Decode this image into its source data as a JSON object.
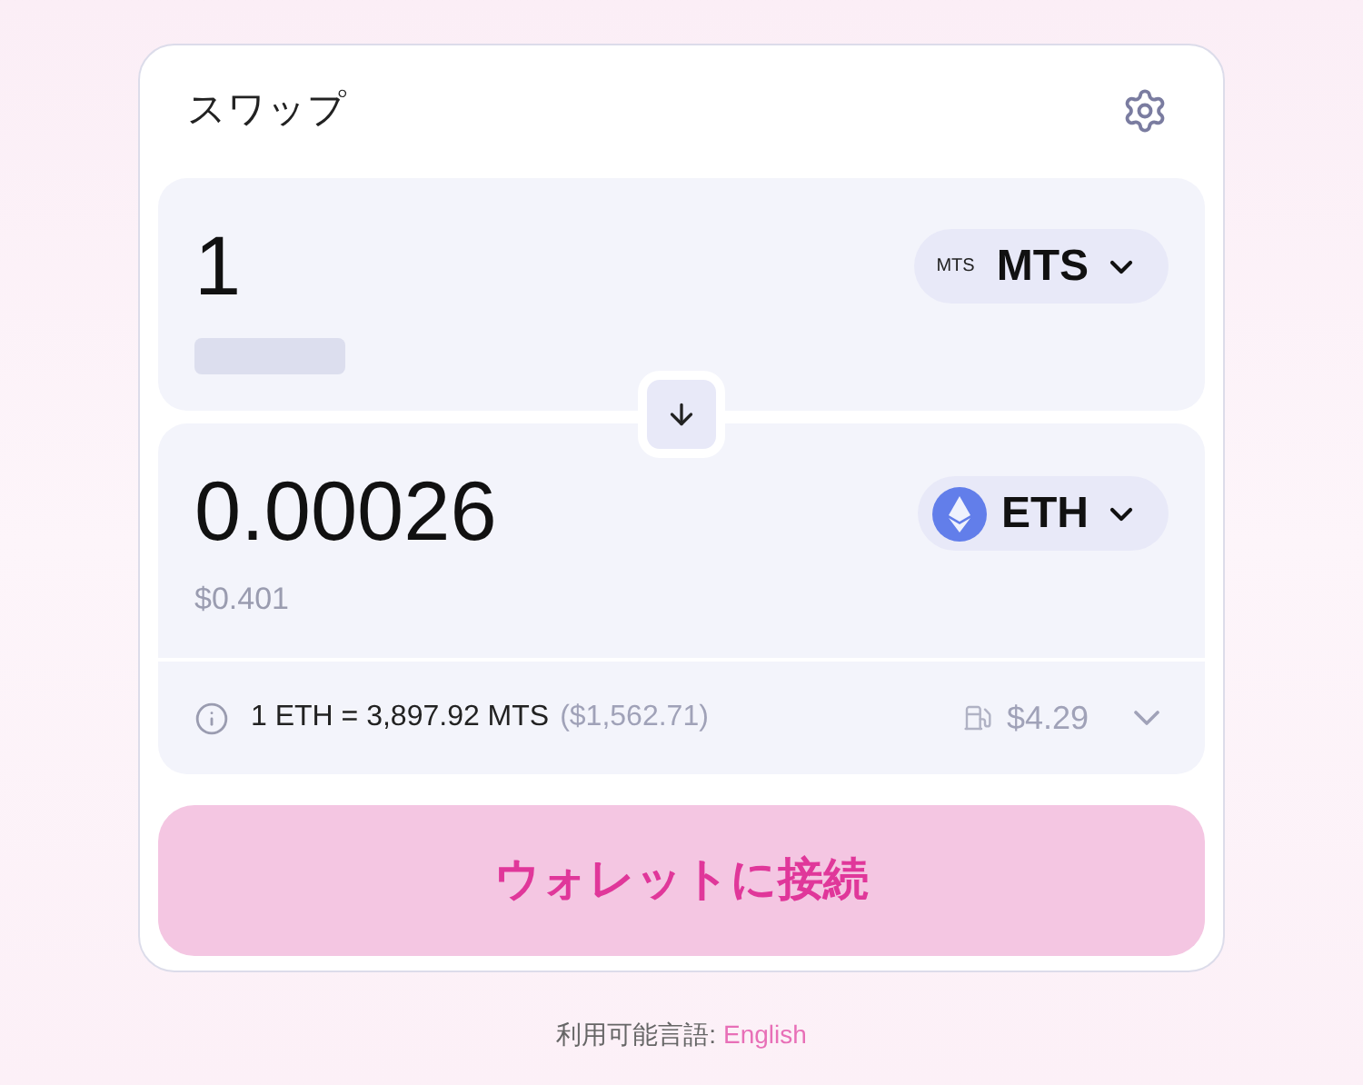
{
  "title": "スワップ",
  "sell": {
    "amount": "1",
    "usd_loading": true,
    "token": {
      "symbol": "MTS",
      "logo_text": "MTS",
      "kind": "text"
    }
  },
  "buy": {
    "amount": "0.00026",
    "usd": "$0.401",
    "token": {
      "symbol": "ETH",
      "kind": "eth"
    }
  },
  "rate": {
    "text": "1 ETH = 3,897.92 MTS",
    "usd": "($1,562.71)",
    "gas": "$4.29",
    "expanded": false
  },
  "connect_button": "ウォレットに接続",
  "footer": {
    "label": "利用可能言語:",
    "link": "English"
  }
}
